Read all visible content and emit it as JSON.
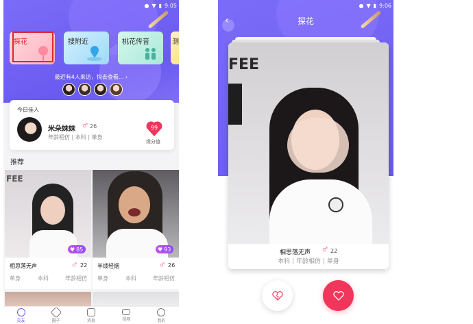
{
  "status_time": "9:05",
  "status_time_2": "9:06",
  "home": {
    "categories": [
      {
        "label": "探花"
      },
      {
        "label": "搜附近"
      },
      {
        "label": "桃花传音"
      },
      {
        "label": "测"
      }
    ],
    "visitors_text": "最近有4人来访，快去查看...",
    "today_best": {
      "title": "今日佳人",
      "name": "米朵妹妹",
      "age": "26",
      "tags": "年龄相仿 | 本科 | 单身",
      "score": "99",
      "score_label": "缘分值"
    },
    "section_title": "推荐",
    "recommend": [
      {
        "name": "相思落无声",
        "age": "22",
        "score": "85",
        "tags": [
          "单身",
          "本科",
          "年龄相仿"
        ]
      },
      {
        "name": "半缕轻烟",
        "age": "26",
        "score": "93",
        "tags": [
          "单身",
          "本科",
          "年龄相仿"
        ]
      }
    ],
    "tabs": [
      {
        "label": "交友",
        "icon": "friends-icon"
      },
      {
        "label": "圈子",
        "icon": "circle-icon"
      },
      {
        "label": "消息",
        "icon": "message-icon"
      },
      {
        "label": "视频",
        "icon": "video-icon"
      },
      {
        "label": "我的",
        "icon": "profile-icon"
      }
    ]
  },
  "tanhua": {
    "title": "探花",
    "card": {
      "name": "相思落无声",
      "age": "22",
      "tags": "本科 | 年龄相仿 | 单身"
    }
  },
  "photo_sign": "FEE",
  "colors": {
    "accent": "#6a5af0",
    "heart": "#f0365b"
  }
}
